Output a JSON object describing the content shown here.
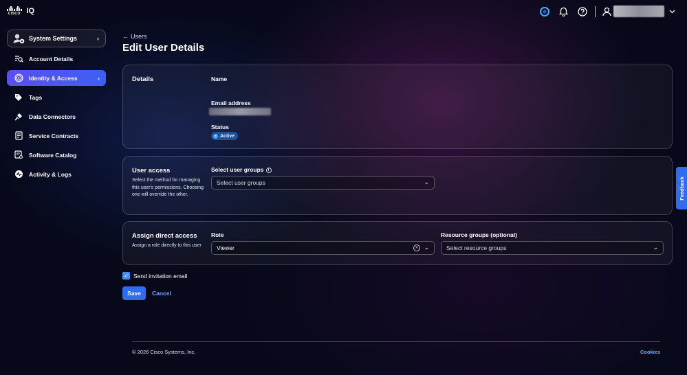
{
  "brand": {
    "logo_word": "CISCO",
    "product": "IQ"
  },
  "sidebar": {
    "system_settings": "System Settings",
    "items": [
      {
        "label": "Account Details",
        "icon": "search-list-icon"
      },
      {
        "label": "Identity & Access",
        "icon": "fingerprint-icon"
      },
      {
        "label": "Tags",
        "icon": "tag-icon"
      },
      {
        "label": "Data Connectors",
        "icon": "plug-icon"
      },
      {
        "label": "Service Contracts",
        "icon": "document-icon"
      },
      {
        "label": "Software Catalog",
        "icon": "catalog-icon"
      },
      {
        "label": "Activity & Logs",
        "icon": "activity-icon"
      }
    ],
    "active_item": "Identity & Access"
  },
  "header": {
    "back_label": "Users",
    "title": "Edit User Details"
  },
  "details": {
    "section_title": "Details",
    "name_label": "Name",
    "email_label": "Email address",
    "status_label": "Status",
    "status_value": "Active"
  },
  "user_access": {
    "title": "User access",
    "description": "Select the method for managing this user's permissions. Choosing one will override the other.",
    "groups_label": "Select user groups",
    "groups_placeholder": "Select user groups"
  },
  "direct_access": {
    "title": "Assign direct access",
    "description": "Assign a role directly to this user",
    "role_label": "Role",
    "role_value": "Viewer",
    "resource_label": "Resource groups (optional)",
    "resource_placeholder": "Select resource groups"
  },
  "form": {
    "send_invite_label": "Send invitation email",
    "send_invite_checked": true,
    "save_label": "Save",
    "cancel_label": "Cancel"
  },
  "footer": {
    "copyright": "© 2026 Cisco Systems, Inc.",
    "cookies": "Cookies"
  },
  "feedback_label": "Feedback",
  "colors": {
    "accent": "#2f6cf0",
    "active_nav": "#5b4ff0",
    "link": "#6ea8ff",
    "status_badge": "#1d4f9a"
  }
}
